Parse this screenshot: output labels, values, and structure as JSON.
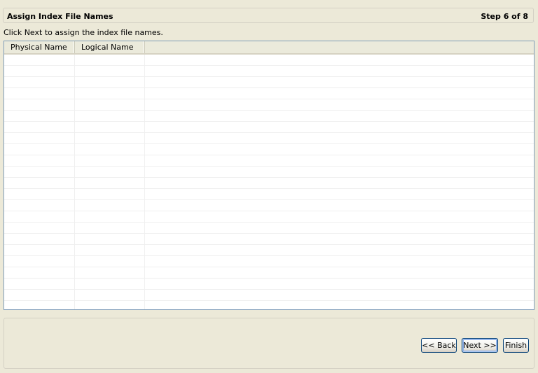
{
  "wizard": {
    "title": "Assign Index File Names",
    "step": "Step 6 of 8",
    "instruction": "Click Next to assign the index file names."
  },
  "table": {
    "columns": [
      "Physical Name",
      "Logical Name"
    ],
    "rows": []
  },
  "buttons": {
    "back": "<< Back",
    "next": "Next >>",
    "finish": "Finish"
  }
}
